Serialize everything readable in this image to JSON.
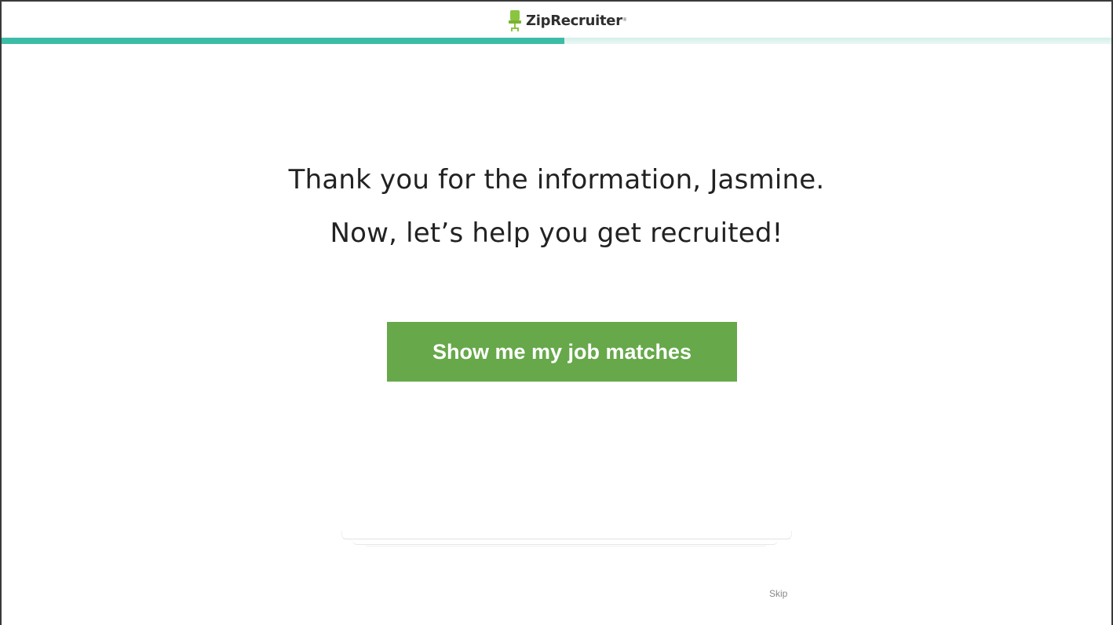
{
  "header": {
    "logo_text": "ZipRecruiter",
    "logo_tm": "®",
    "logo_icon": "chair-icon",
    "brand_color": "#8ac540"
  },
  "progress": {
    "fraction": 0.507,
    "fill_color": "#3cbca6",
    "track_color": "#d4efe9"
  },
  "main": {
    "headline_line1": "Thank you for the information, Jasmine.",
    "headline_line2": "Now, let’s help you get recruited!",
    "cta_label": "Show me my job matches",
    "cta_color": "#66a84a"
  },
  "footer": {
    "skip_label": "Skip"
  }
}
